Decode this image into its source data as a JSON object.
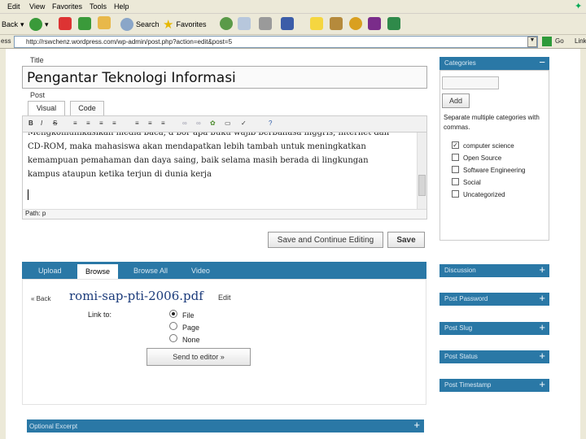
{
  "browser": {
    "menu": [
      "Edit",
      "View",
      "Favorites",
      "Tools",
      "Help"
    ],
    "toolbar": {
      "back": "Back",
      "search": "Search",
      "favorites": "Favorites"
    },
    "address_label": "ess",
    "url": "http://rswchenz.wordpress.com/wp-admin/post.php?action=edit&post=5",
    "go": "Go",
    "links": "Link"
  },
  "post": {
    "title_label": "Title",
    "title_value": "Pengantar Teknologi Informasi",
    "post_label": "Post",
    "tabs": [
      "Visual",
      "Code"
    ],
    "body_lines": [
      "Mengkomunikasikan media baca, d  bor apa buku wajib berbahasa inggris, internet dan",
      "CD-ROM, maka mahasiswa akan mendapatkan lebih tambah untuk meningkatkan",
      "kemampuan pemahaman dan daya saing, baik selama masih berada di lingkungan",
      "kampus ataupun ketika terjun di dunia kerja"
    ],
    "path": "Path: p",
    "save_continue": "Save and Continue Editing",
    "save": "Save"
  },
  "uploader": {
    "tabs": [
      "Upload",
      "Browse",
      "Browse All",
      "Video"
    ],
    "active_tab": "Browse",
    "back": "« Back",
    "filename": "romi-sap-pti-2006.pdf",
    "edit": "Edit",
    "link_to": "Link to:",
    "options": [
      "File",
      "Page",
      "None"
    ],
    "selected": "File",
    "send": "Send to editor »"
  },
  "sidebar": {
    "categories": "Categories",
    "add": "Add",
    "hint": "Separate multiple categories with commas.",
    "items": [
      {
        "label": "computer science",
        "checked": true
      },
      {
        "label": "Open Source",
        "checked": false
      },
      {
        "label": "Software Engineering",
        "checked": false
      },
      {
        "label": "Social",
        "checked": false
      },
      {
        "label": "Uncategorized",
        "checked": false
      }
    ],
    "panels": [
      "Discussion",
      "Post Password",
      "Post Slug",
      "Post Status",
      "Post Timestamp"
    ],
    "minus": "−",
    "plus": "+"
  },
  "excerpt": "Optional Excerpt"
}
